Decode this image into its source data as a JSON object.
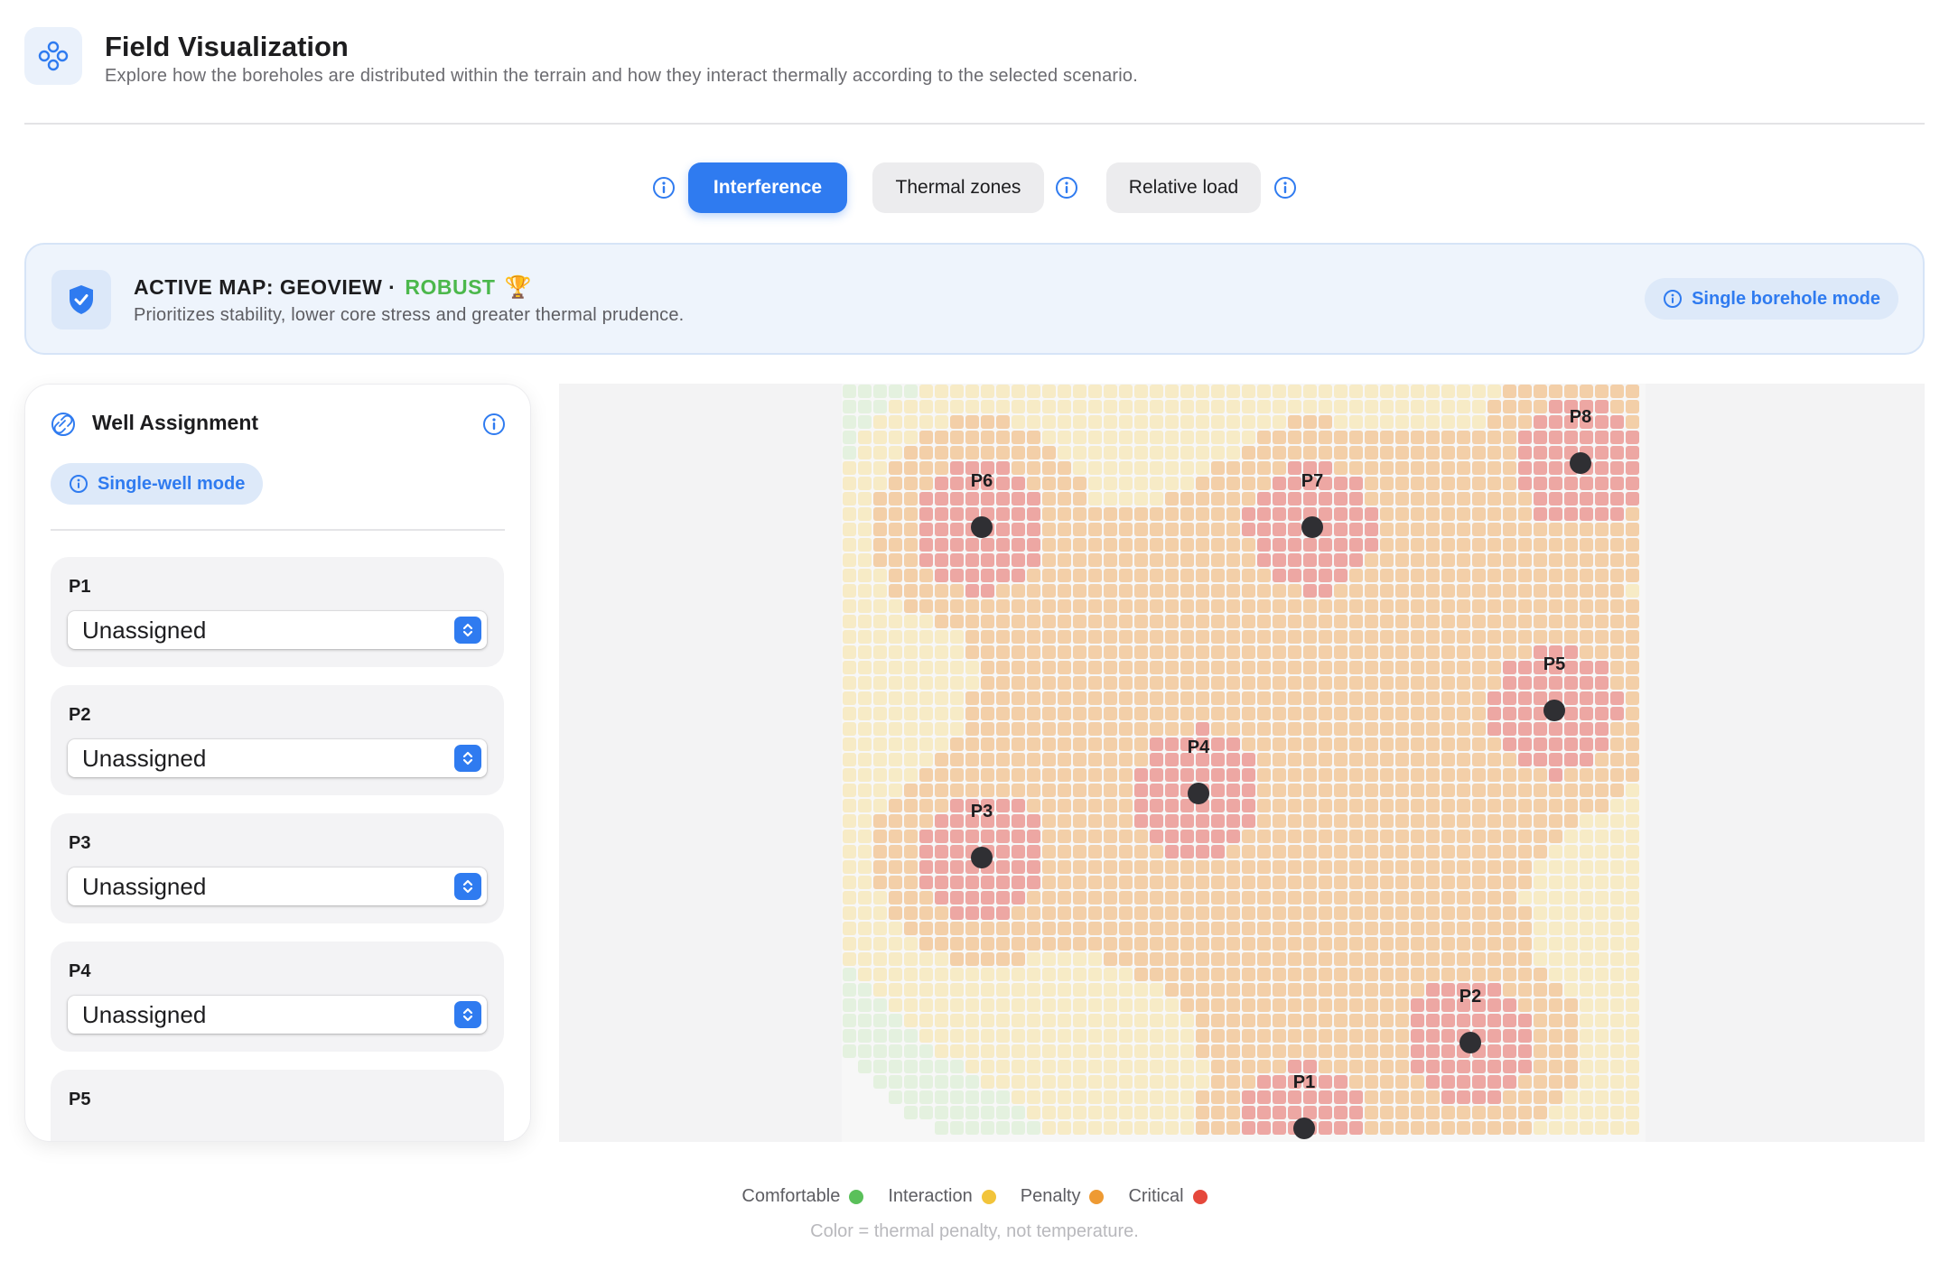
{
  "header": {
    "title": "Field Visualization",
    "subtitle": "Explore how the boreholes are distributed within the terrain and how they interact thermally according to the selected scenario."
  },
  "tabs": [
    {
      "label": "Interference",
      "active": true
    },
    {
      "label": "Thermal zones",
      "active": false
    },
    {
      "label": "Relative load",
      "active": false
    }
  ],
  "banner": {
    "title_prefix": "ACTIVE MAP: GEOVIEW ·",
    "status": "ROBUST",
    "trophy": "🏆",
    "description": "Prioritizes stability, lower core stress and greater thermal prudence.",
    "mode_button": "Single borehole mode"
  },
  "panel": {
    "title": "Well Assignment",
    "mode_pill": "Single-well mode",
    "wells": [
      {
        "label": "P1",
        "value": "Unassigned"
      },
      {
        "label": "P2",
        "value": "Unassigned"
      },
      {
        "label": "P3",
        "value": "Unassigned"
      },
      {
        "label": "P4",
        "value": "Unassigned"
      },
      {
        "label": "P5",
        "value": ""
      }
    ]
  },
  "map": {
    "boreholes": [
      {
        "label": "P1"
      },
      {
        "label": "P2"
      },
      {
        "label": "P3"
      },
      {
        "label": "P4"
      },
      {
        "label": "P5"
      },
      {
        "label": "P6"
      },
      {
        "label": "P7"
      },
      {
        "label": "P8"
      }
    ]
  },
  "legend": {
    "items": [
      {
        "label": "Comfortable",
        "color": "#5ac05a"
      },
      {
        "label": "Interaction",
        "color": "#f2c43a"
      },
      {
        "label": "Penalty",
        "color": "#ee9a33"
      },
      {
        "label": "Critical",
        "color": "#e5483b"
      }
    ],
    "note": "Color = thermal penalty, not temperature."
  },
  "colors": {
    "accent": "#2f7bf0",
    "robust": "#4cb84c",
    "cell_comfortable": "#e4f1df",
    "cell_interaction": "#f7ebc6",
    "cell_penalty": "#f3cfa8",
    "cell_critical": "#eda7a3",
    "cell_empty": "#f7f7f7"
  }
}
